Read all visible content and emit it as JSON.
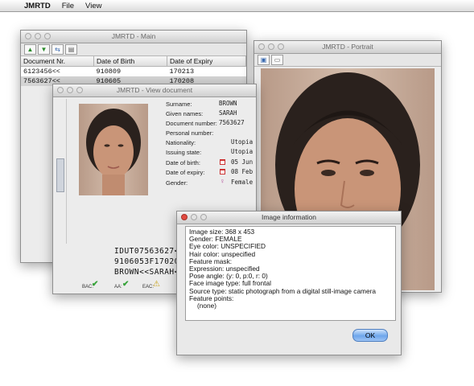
{
  "menubar": {
    "app_name": "JMRTD",
    "items": [
      "File",
      "View"
    ]
  },
  "main_window": {
    "title": "JMRTD - Main",
    "columns": [
      "Document Nr.",
      "Date of Birth",
      "Date of Expiry"
    ],
    "rows": [
      [
        "6123456<<",
        "910809",
        "170213"
      ],
      [
        "7563627<<",
        "910605",
        "170208"
      ]
    ]
  },
  "view_window": {
    "title": "JMRTD - View document",
    "fields": [
      {
        "label": "Surname:",
        "value": "BROWN"
      },
      {
        "label": "Given names:",
        "value": "SARAH"
      },
      {
        "label": "Document number:",
        "value": "7563627"
      },
      {
        "label": "Personal number:",
        "value": ""
      },
      {
        "label": "Nationality:",
        "value": "Utopia"
      },
      {
        "label": "Issuing state:",
        "value": "Utopia"
      },
      {
        "label": "Date of birth:",
        "value": "05 Jun"
      },
      {
        "label": "Date of expiry:",
        "value": "08 Feb"
      },
      {
        "label": "Gender:",
        "value": "Female"
      }
    ],
    "mrz": [
      "IDUT07563627<",
      "9106053F17020",
      "BROWN<<SARAH<"
    ],
    "status": [
      {
        "label": "BAC:",
        "icon": "check-icon"
      },
      {
        "label": "AA:",
        "icon": "check-icon"
      },
      {
        "label": "EAC:",
        "icon": "warning-icon"
      }
    ]
  },
  "portrait_window": {
    "title": "JMRTD - Portrait"
  },
  "image_info": {
    "title": "Image information",
    "lines": [
      "Image size: 368 x 453",
      "Gender: FEMALE",
      "Eye color: UNSPECIFIED",
      "Hair color: unspecified",
      "Feature mask:",
      "Expression: unspecified",
      "Pose angle: (y: 0, p:0, r: 0)",
      "Face image type: full frontal",
      "Source type: static photograph from a digital still-image camera",
      "Feature points:",
      "  (none)"
    ],
    "ok_label": "OK"
  }
}
